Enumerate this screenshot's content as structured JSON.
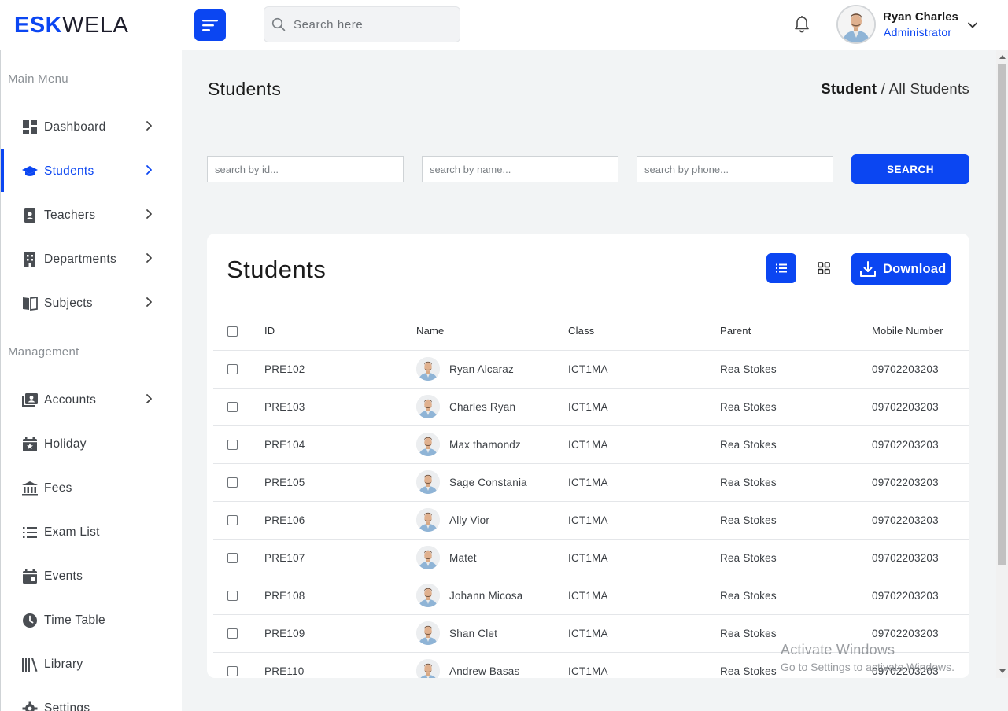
{
  "app": {
    "logo_bold": "ESK",
    "logo_light": "WELA",
    "search_placeholder": "Search here"
  },
  "user": {
    "name": "Ryan Charles",
    "role": "Administrator"
  },
  "sidebar": {
    "section_main": "Main Menu",
    "section_management": "Management",
    "main_items": [
      {
        "label": "Dashboard",
        "icon": "dashboard-icon"
      },
      {
        "label": "Students",
        "icon": "graduation-cap-icon",
        "active": true
      },
      {
        "label": "Teachers",
        "icon": "id-badge-icon"
      },
      {
        "label": "Departments",
        "icon": "building-icon"
      },
      {
        "label": "Subjects",
        "icon": "book-icon"
      }
    ],
    "management_items": [
      {
        "label": "Accounts",
        "icon": "accounts-icon"
      },
      {
        "label": "Holiday",
        "icon": "calendar-star-icon"
      },
      {
        "label": "Fees",
        "icon": "bank-icon"
      },
      {
        "label": "Exam List",
        "icon": "list-icon"
      },
      {
        "label": "Events",
        "icon": "calendar-icon"
      },
      {
        "label": "Time Table",
        "icon": "clock-icon"
      },
      {
        "label": "Library",
        "icon": "library-icon"
      },
      {
        "label": "Settings",
        "icon": "gear-icon"
      }
    ]
  },
  "page": {
    "title": "Students",
    "breadcrumb_current": "Student",
    "breadcrumb_separator": " / ",
    "breadcrumb_page": "All Students"
  },
  "filters": {
    "id_placeholder": "search by id...",
    "name_placeholder": "search by name...",
    "phone_placeholder": "search by phone...",
    "search_label": "SEARCH"
  },
  "table": {
    "title": "Students",
    "download_label": "Download",
    "headers": {
      "id": "ID",
      "name": "Name",
      "class": "Class",
      "parent": "Parent",
      "mobile": "Mobile Number"
    },
    "rows": [
      {
        "id": "PRE102",
        "name": "Ryan Alcaraz",
        "class": "ICT1MA",
        "parent": "Rea Stokes",
        "mobile": "09702203203"
      },
      {
        "id": "PRE103",
        "name": "Charles Ryan",
        "class": "ICT1MA",
        "parent": "Rea Stokes",
        "mobile": "09702203203"
      },
      {
        "id": "PRE104",
        "name": "Max thamondz",
        "class": "ICT1MA",
        "parent": "Rea Stokes",
        "mobile": "09702203203"
      },
      {
        "id": "PRE105",
        "name": "Sage Constania",
        "class": "ICT1MA",
        "parent": "Rea Stokes",
        "mobile": "09702203203"
      },
      {
        "id": "PRE106",
        "name": "Ally Vior",
        "class": "ICT1MA",
        "parent": "Rea Stokes",
        "mobile": "09702203203"
      },
      {
        "id": "PRE107",
        "name": "Matet",
        "class": "ICT1MA",
        "parent": "Rea Stokes",
        "mobile": "09702203203"
      },
      {
        "id": "PRE108",
        "name": "Johann Micosa",
        "class": "ICT1MA",
        "parent": "Rea Stokes",
        "mobile": "09702203203"
      },
      {
        "id": "PRE109",
        "name": "Shan Clet",
        "class": "ICT1MA",
        "parent": "Rea Stokes",
        "mobile": "09702203203"
      },
      {
        "id": "PRE110",
        "name": "Andrew Basas",
        "class": "ICT1MA",
        "parent": "Rea Stokes",
        "mobile": "09702203203"
      }
    ]
  },
  "watermark": {
    "line1": "Activate Windows",
    "line2": "Go to Settings to activate Windows."
  },
  "colors": {
    "accent": "#0b46f2",
    "background": "#f2f4f5"
  }
}
